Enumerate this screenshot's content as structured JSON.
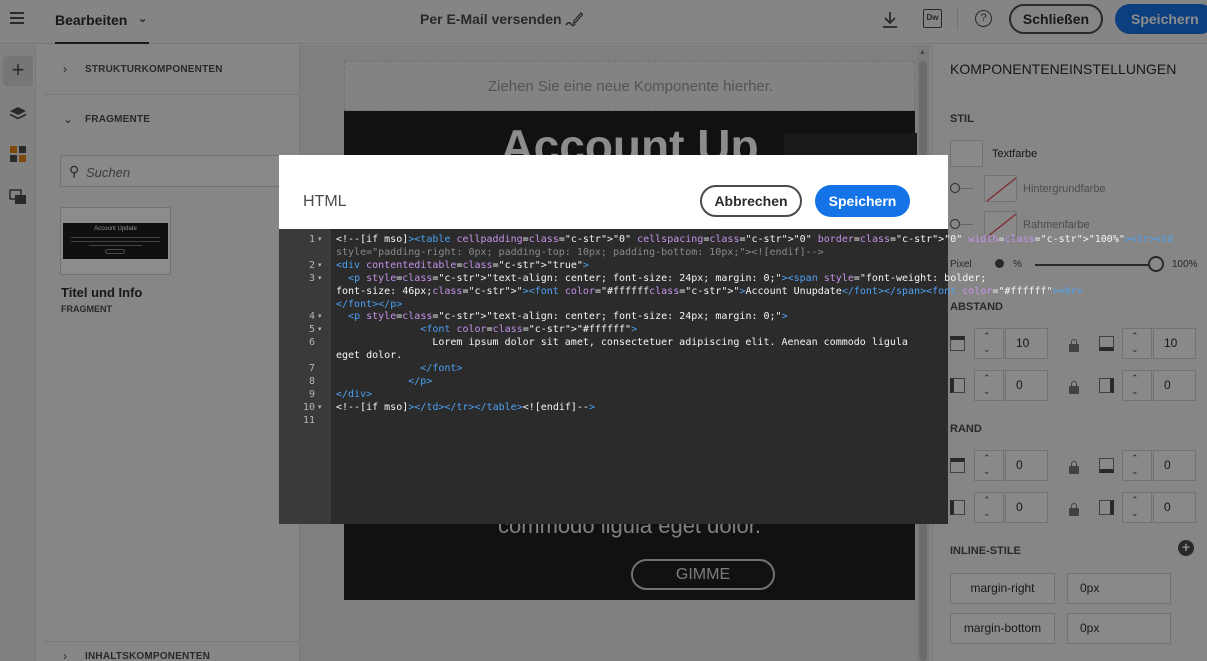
{
  "topbar": {
    "mode_label": "Bearbeiten",
    "email_label": "Per E-Mail versenden",
    "dw_label": "Dw",
    "help_label": "?",
    "close_label": "Schließen",
    "save_label": "Speichern"
  },
  "left_panel": {
    "section_structure": "STRUKTURKOMPONENTEN",
    "section_fragments": "FRAGMENTE",
    "section_content": "INHALTSKOMPONENTEN",
    "search_placeholder": "Suchen",
    "fragment": {
      "thumb_title": "Account Update",
      "title": "Titel und Info",
      "type": "FRAGMENT"
    }
  },
  "canvas": {
    "dropzone_text": "Ziehen Sie eine neue Komponente hierher.",
    "big_title": "Account Up",
    "body_text": "commodo ligula eget dolor.",
    "cta_label": "GIMME"
  },
  "right_panel": {
    "title": "KOMPONENTENEINSTELLUNGEN",
    "stil": "STIL",
    "textfarbe": "Textfarbe",
    "hintergrundfarbe": "Hintergrundfarbe",
    "rahmenfarbe": "Rahmenfarbe",
    "pixel": "Pixel",
    "percent": "%",
    "max": "100%",
    "abstand": "ABSTAND",
    "rand": "RAND",
    "abstand_values": [
      "10",
      "10",
      "0",
      "0"
    ],
    "rand_values": [
      "0",
      "0",
      "0",
      "0"
    ],
    "inline_styles": "INLINE-STILE",
    "props": [
      {
        "name": "margin-right",
        "value": "0px"
      },
      {
        "name": "margin-bottom",
        "value": "0px"
      }
    ]
  },
  "dialog": {
    "title": "HTML",
    "cancel_label": "Abbrechen",
    "save_label": "Speichern",
    "line_numbers": [
      "1",
      "2",
      "3",
      "4",
      "5",
      "6",
      "7",
      "8",
      "9",
      "10",
      "11"
    ],
    "code_lines": [
      "<!--[if mso]><table cellpadding=\"0\" cellspacing=\"0\" border=\"0\" width=\"100%\"><tr><td",
      "style=\"padding-right: 0px; padding-top: 10px; padding-bottom: 10px;\"><![endif]-->",
      "<div contenteditable=\"true\">",
      "  <p style=\"text-align: center; font-size: 24px; margin: 0;\"><span style=\"font-weight: bolder;",
      "font-size: 46px;\"><font color=\"#ffffff\">Account Unupdate</font></span><font color=\"#ffffff\"><br>",
      "</font></p>",
      "  <p style=\"text-align: center; font-size: 24px; margin: 0;\">",
      "              <font color=\"#ffffff\">",
      "                Lorem ipsum dolor sit amet, consectetuer adipiscing elit. Aenean commodo ligula",
      "eget dolor.",
      "              </font>",
      "            </p>",
      "</div>",
      "<!--[if mso]></td></tr></table><![endif]-->",
      ""
    ]
  },
  "colors": {
    "accent": "#1473e6",
    "editor_bg": "#2b2b2b",
    "email_bg": "#1f1f1f"
  }
}
